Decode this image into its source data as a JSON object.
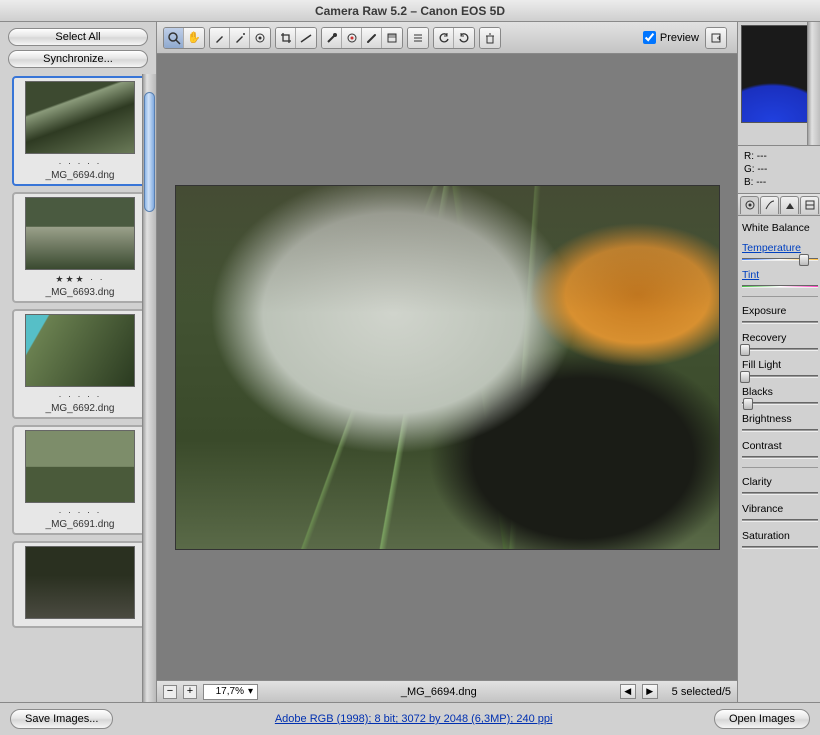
{
  "window": {
    "title": "Camera Raw 5.2  –  Canon EOS 5D"
  },
  "filmstrip": {
    "select_all": "Select All",
    "synchronize": "Synchronize...",
    "items": [
      {
        "rating": "·  ·  ·  ·  ·",
        "label": "_MG_6694.dng",
        "selected": true
      },
      {
        "rating": "★★★ ·  ·",
        "label": "_MG_6693.dng",
        "selected": false
      },
      {
        "rating": "·  ·  ·  ·  ·",
        "label": "_MG_6692.dng",
        "selected": false
      },
      {
        "rating": "·  ·  ·  ·  ·",
        "label": "_MG_6691.dng",
        "selected": false
      },
      {
        "rating": "",
        "label": "",
        "selected": false
      }
    ]
  },
  "toolbar": {
    "preview_label": "Preview"
  },
  "status": {
    "zoom": "17,7%",
    "filename": "_MG_6694.dng",
    "selected": "5 selected/5"
  },
  "rgb": {
    "r": "R:   ---",
    "g": "G:   ---",
    "b": "B:   ---"
  },
  "panel": {
    "wb_label": "White Balance",
    "temp_label": "Temperature",
    "tint_label": "Tint",
    "exposure": "Exposure",
    "recovery": "Recovery",
    "filllight": "Fill Light",
    "blacks": "Blacks",
    "brightness": "Brightness",
    "contrast": "Contrast",
    "clarity": "Clarity",
    "vibrance": "Vibrance",
    "saturation": "Saturation"
  },
  "footer": {
    "save": "Save Images...",
    "meta": "Adobe RGB (1998); 8 bit; 3072 by 2048 (6,3MP); 240 ppi",
    "open": "Open Images"
  }
}
